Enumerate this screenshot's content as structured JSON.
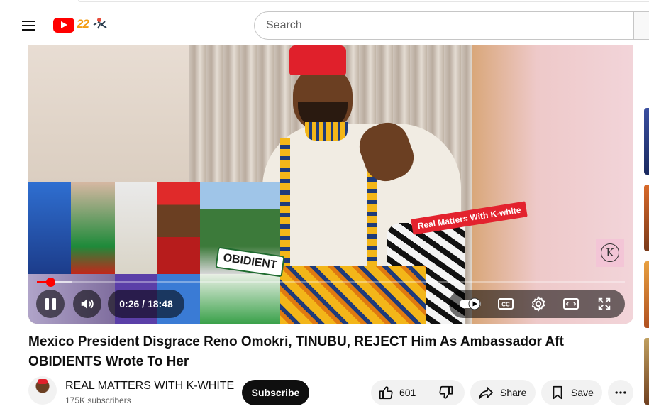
{
  "header": {
    "search_placeholder": "Search"
  },
  "player": {
    "overlay_tag": "Real Matters With K-white",
    "watermark_letter": "K",
    "obidient_text": "OBIDIENT",
    "time_display": "0:26 / 18:48",
    "progress_fraction": 0.023,
    "buffer_fraction": 0.06
  },
  "video": {
    "title": "Mexico President Disgrace Reno Omokri, TINUBU, REJECT Him As Ambassador Aft OBIDIENTS Wrote To Her"
  },
  "channel": {
    "name": "REAL MATTERS WITH K-WHITE",
    "subscribers": "175K subscribers",
    "subscribe_label": "Subscribe"
  },
  "actions": {
    "like_count": "601",
    "share_label": "Share",
    "save_label": "Save"
  },
  "colors": {
    "accent": "#ff0000",
    "subscribe_bg": "#0f0f0f",
    "pill_bg": "#f2f2f2"
  },
  "icons": [
    "menu-icon",
    "youtube-logo-icon",
    "pause-icon",
    "volume-icon",
    "autoplay-toggle-icon",
    "captions-icon",
    "settings-gear-icon",
    "theater-mode-icon",
    "fullscreen-icon",
    "thumbs-up-icon",
    "thumbs-down-icon",
    "share-arrow-icon",
    "save-bookmark-icon",
    "more-dots-icon"
  ]
}
